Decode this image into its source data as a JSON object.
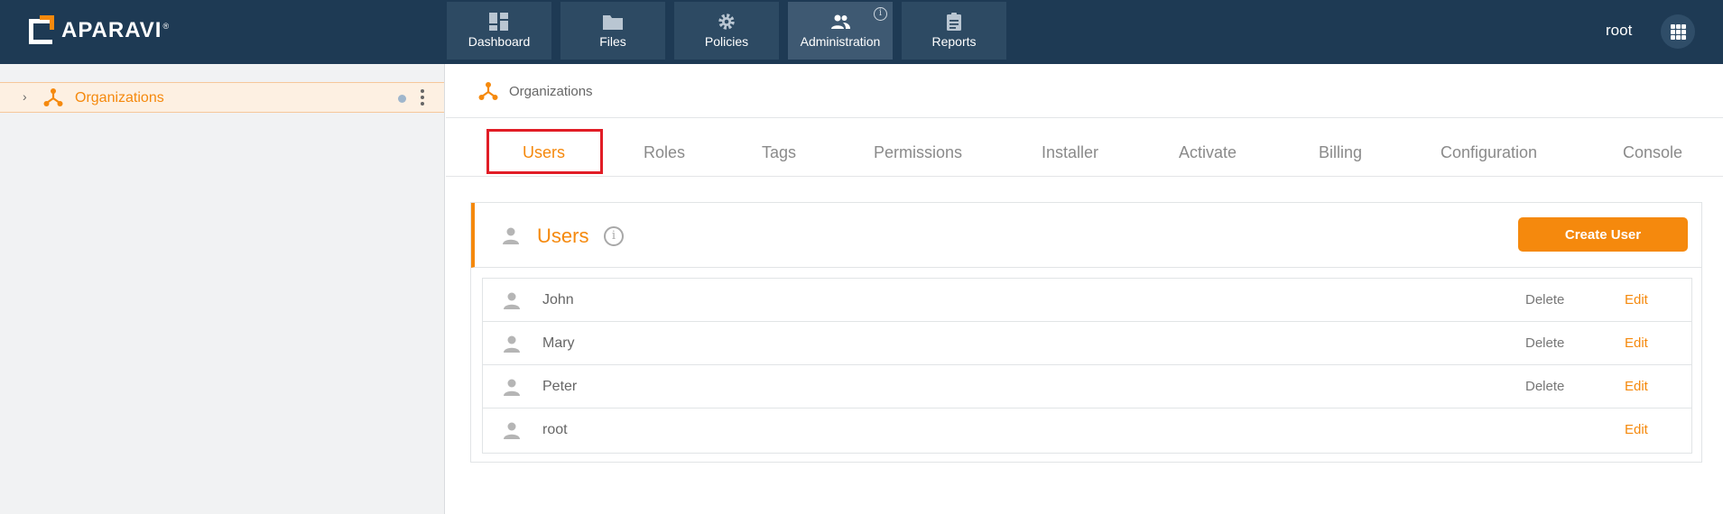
{
  "brand": {
    "name": "APARAVI",
    "reg": "®"
  },
  "nav": {
    "items": [
      {
        "label": "Dashboard",
        "icon": "dashboard-icon"
      },
      {
        "label": "Files",
        "icon": "folder-icon"
      },
      {
        "label": "Policies",
        "icon": "gear-icon"
      },
      {
        "label": "Administration",
        "icon": "people-icon",
        "active": true,
        "badge": "i"
      },
      {
        "label": "Reports",
        "icon": "clipboard-icon"
      }
    ],
    "user": "root",
    "apps_icon": "grid-icon"
  },
  "sidebar": {
    "items": [
      {
        "label": "Organizations",
        "expand_glyph": "›"
      }
    ]
  },
  "breadcrumb": {
    "label": "Organizations"
  },
  "tabs": [
    {
      "label": "Users",
      "active": true
    },
    {
      "label": "Roles"
    },
    {
      "label": "Tags"
    },
    {
      "label": "Permissions"
    },
    {
      "label": "Installer"
    },
    {
      "label": "Activate"
    },
    {
      "label": "Billing"
    },
    {
      "label": "Configuration"
    },
    {
      "label": "Console"
    }
  ],
  "panel": {
    "title": "Users",
    "info_glyph": "i",
    "create_label": "Create User",
    "delete_label": "Delete",
    "edit_label": "Edit",
    "users": [
      {
        "name": "John",
        "deletable": true
      },
      {
        "name": "Mary",
        "deletable": true
      },
      {
        "name": "Peter",
        "deletable": true
      },
      {
        "name": "root",
        "deletable": false
      }
    ]
  },
  "colors": {
    "accent": "#f5890d",
    "topbar": "#1e3a54",
    "highlight": "#e11d26"
  }
}
